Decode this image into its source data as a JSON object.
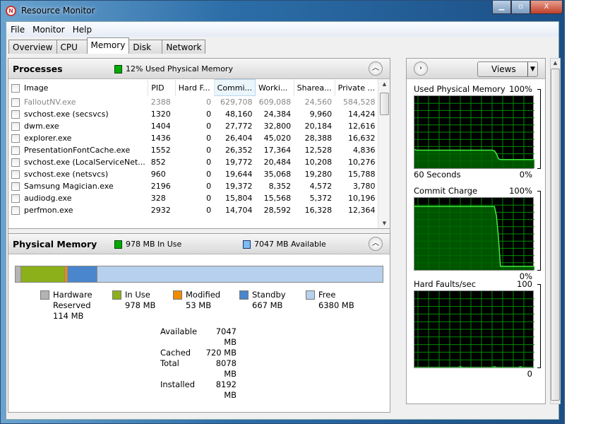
{
  "window": {
    "title": "Resource Monitor",
    "minimize": "▁",
    "maximize": "▫",
    "close": "X"
  },
  "menu": [
    "File",
    "Monitor",
    "Help"
  ],
  "tabs": [
    "Overview",
    "CPU",
    "Memory",
    "Disk",
    "Network"
  ],
  "active_tab": "Memory",
  "processes": {
    "title": "Processes",
    "indicator": "12% Used Physical Memory",
    "columns": [
      "Image",
      "PID",
      "Hard F...",
      "Commi...",
      "Worki...",
      "Sharea...",
      "Private ..."
    ],
    "rows": [
      [
        "FalloutNV.exe",
        "2388",
        "0",
        "629,708",
        "609,088",
        "24,560",
        "584,528"
      ],
      [
        "svchost.exe (secsvcs)",
        "1320",
        "0",
        "48,160",
        "24,384",
        "9,960",
        "14,424"
      ],
      [
        "dwm.exe",
        "1404",
        "0",
        "27,772",
        "32,800",
        "20,184",
        "12,616"
      ],
      [
        "explorer.exe",
        "1436",
        "0",
        "26,404",
        "45,020",
        "28,388",
        "16,632"
      ],
      [
        "PresentationFontCache.exe",
        "1552",
        "0",
        "26,352",
        "17,364",
        "12,528",
        "4,836"
      ],
      [
        "svchost.exe (LocalServiceNet...",
        "852",
        "0",
        "19,772",
        "20,484",
        "10,208",
        "10,276"
      ],
      [
        "svchost.exe (netsvcs)",
        "960",
        "0",
        "19,644",
        "35,068",
        "19,280",
        "15,788"
      ],
      [
        "Samsung Magician.exe",
        "2196",
        "0",
        "19,372",
        "8,352",
        "4,572",
        "3,780"
      ],
      [
        "audiodg.exe",
        "328",
        "0",
        "15,804",
        "15,568",
        "5,372",
        "10,196"
      ],
      [
        "perfmon.exe",
        "2932",
        "0",
        "14,704",
        "28,592",
        "16,328",
        "12,364"
      ]
    ]
  },
  "physical_memory": {
    "title": "Physical Memory",
    "in_use_indicator": "978 MB In Use",
    "available_indicator": "7047 MB Available",
    "legend": [
      {
        "l1": "Hardware",
        "l2": "Reserved",
        "value": "114 MB",
        "mb": 114,
        "color": "#b4b4b4"
      },
      {
        "l1": "In Use",
        "value": "978 MB",
        "mb": 978,
        "color": "#8bb01a"
      },
      {
        "l1": "Modified",
        "value": "53 MB",
        "mb": 53,
        "color": "#f08c00"
      },
      {
        "l1": "Standby",
        "value": "667 MB",
        "mb": 667,
        "color": "#4a86cc"
      },
      {
        "l1": "Free",
        "value": "6380 MB",
        "mb": 6380,
        "color": "#b7d0ee"
      }
    ],
    "stats": [
      [
        "Available",
        "7047 MB"
      ],
      [
        "Cached",
        "720 MB"
      ],
      [
        "Total",
        "8078 MB"
      ],
      [
        "Installed",
        "8192 MB"
      ]
    ]
  },
  "right": {
    "views_label": "Views",
    "graphs": [
      {
        "title": "Used Physical Memory",
        "max": "100%",
        "min": "0%",
        "footer": "60 Seconds",
        "values": [
          26,
          25,
          25,
          25,
          25,
          25,
          25,
          25,
          25,
          25,
          25,
          25,
          25,
          25,
          25,
          25,
          25,
          25,
          25,
          25,
          25,
          25,
          25,
          25,
          25,
          25,
          25,
          25,
          25,
          25,
          25,
          25,
          25,
          25,
          25,
          25,
          25,
          25,
          25,
          25,
          24,
          20,
          13,
          12,
          12,
          12,
          12,
          12,
          12,
          12,
          12,
          12,
          12,
          12,
          12,
          12,
          12,
          12,
          12,
          12,
          12
        ]
      },
      {
        "title": "Commit Charge",
        "max": "100%",
        "min": "0%",
        "values": [
          88,
          88,
          88,
          88,
          88,
          88,
          88,
          88,
          88,
          88,
          88,
          88,
          88,
          88,
          88,
          88,
          88,
          88,
          88,
          88,
          88,
          88,
          88,
          88,
          88,
          88,
          88,
          88,
          88,
          88,
          88,
          88,
          88,
          88,
          88,
          88,
          88,
          88,
          88,
          88,
          88,
          75,
          45,
          5,
          5,
          5,
          5,
          5,
          5,
          5,
          5,
          5,
          5,
          5,
          5,
          5,
          5,
          5,
          5,
          5,
          5
        ]
      },
      {
        "title": "Hard Faults/sec",
        "max": "100",
        "min": "0",
        "values": [
          0,
          0,
          0,
          0,
          0,
          0,
          0,
          0,
          0,
          0,
          0,
          0,
          0,
          0,
          0,
          0,
          0,
          0,
          0,
          0,
          0,
          0,
          0,
          1,
          0,
          0,
          0,
          0,
          0,
          0,
          0,
          0,
          0,
          0,
          0,
          0,
          0,
          0,
          0,
          0,
          1,
          0,
          0,
          0,
          0,
          0,
          0,
          0,
          0,
          0,
          0,
          0,
          0,
          1,
          0,
          0,
          0,
          0,
          0,
          0,
          0
        ]
      }
    ]
  },
  "colors": {
    "graph_line": "#3cf03c",
    "graph_fill": "#006400",
    "graph_grid": "#008c00"
  }
}
